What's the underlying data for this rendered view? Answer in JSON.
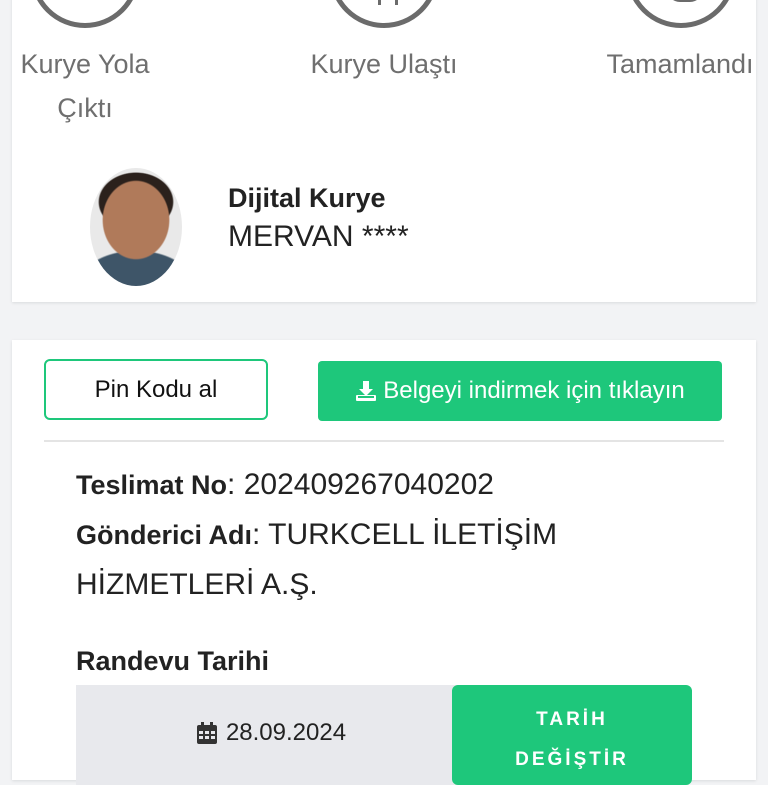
{
  "status_steps": [
    {
      "label_line1": "Kurye Yola",
      "label_line2": "Çıktı"
    },
    {
      "label_line1": "Kurye Ulaştı",
      "label_line2": ""
    },
    {
      "label_line1": "Tamamlandı",
      "label_line2": ""
    }
  ],
  "courier": {
    "title": "Dijital Kurye",
    "name": "MERVAN ****"
  },
  "actions": {
    "pin_label": "Pin Kodu al",
    "download_label": "Belgeyi indirmek için tıklayın",
    "download_icon": "download-icon"
  },
  "delivery": {
    "no_label": "Teslimat No",
    "no_value": ": 202409267040202",
    "sender_label": "Gönderici Adı",
    "sender_value": ": TURKCELL İLETİŞİM HİZMETLERİ A.Ş."
  },
  "appointment": {
    "label": "Randevu Tarihi",
    "date": "28.09.2024",
    "calendar_icon": "calendar-icon",
    "change_label_line1": "TARİH",
    "change_label_line2": "DEĞİŞTİR"
  },
  "colors": {
    "accent": "#1ec77b",
    "step_circle": "#6b6b6b"
  }
}
